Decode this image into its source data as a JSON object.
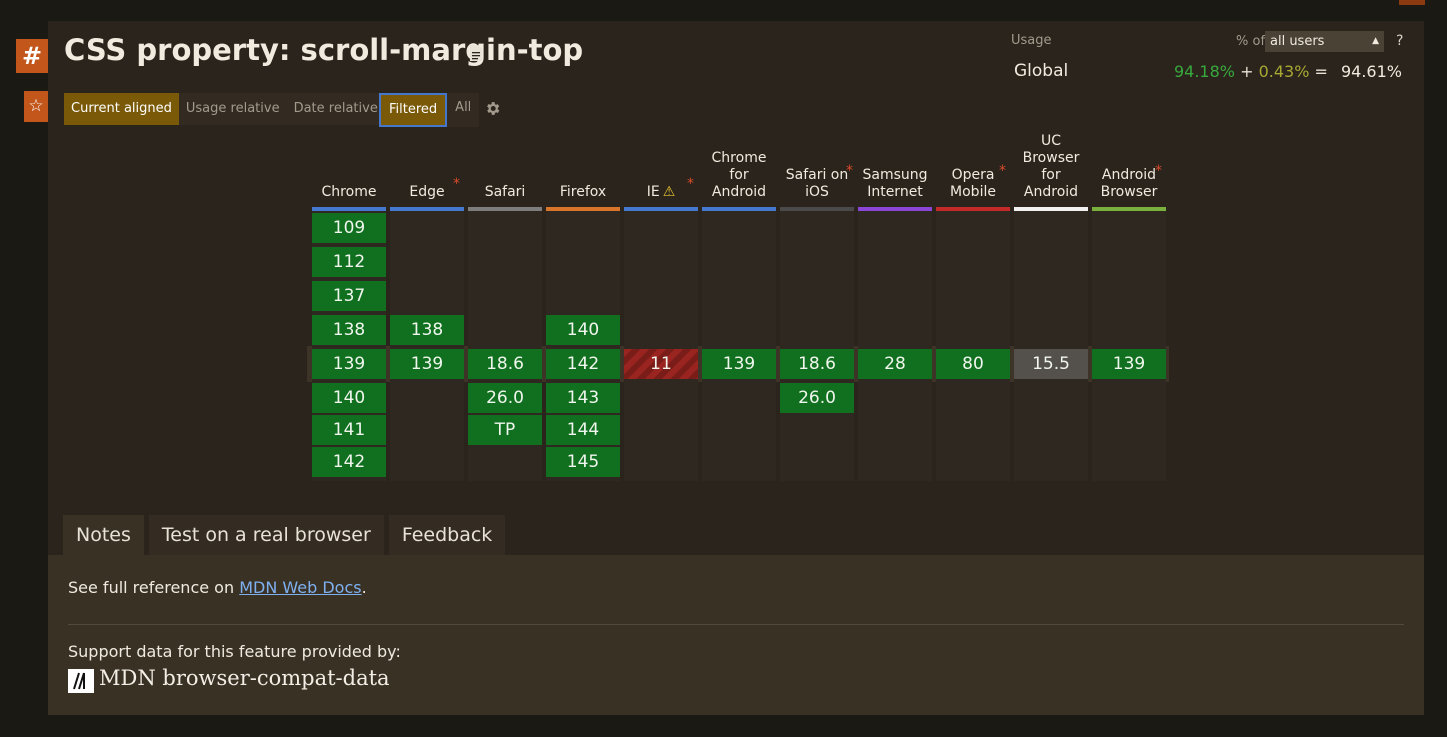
{
  "page": {
    "title": "CSS property: scroll-margin-top",
    "hash_icon": "hash-icon",
    "star_icon": "star-icon",
    "doc_icon": "document-icon"
  },
  "views": {
    "buttons": [
      {
        "label": "Current aligned",
        "active": true
      },
      {
        "label": "Usage relative",
        "active": false
      },
      {
        "label": "Date relative",
        "active": false
      }
    ],
    "filters": [
      {
        "label": "Filtered",
        "active": true
      },
      {
        "label": "All",
        "active": false
      }
    ],
    "settings_icon": "gear-icon"
  },
  "usage": {
    "label": "Usage",
    "pct_of": "% of",
    "select_value": "all users",
    "help": "?",
    "region": "Global",
    "full": "94.18%",
    "plus": "+",
    "partial": "0.43%",
    "equals": "=",
    "total": "94.61%"
  },
  "colors": {
    "supported": "#11701f",
    "unsupported": "#9a2420",
    "unknown": "#54514c",
    "accent": "#c2561b"
  },
  "browsers": [
    {
      "name": "Chrome",
      "color": "#4479cf",
      "note": false,
      "warn": false,
      "versions": [
        "109",
        "112",
        "137",
        "138",
        "139",
        "140",
        "141",
        "142"
      ]
    },
    {
      "name": "Edge",
      "color": "#4479cf",
      "note": true,
      "warn": false,
      "versions": [
        "",
        "",
        "",
        "138",
        "139",
        "",
        "",
        ""
      ]
    },
    {
      "name": "Safari",
      "color": "#7d7d7d",
      "note": false,
      "warn": false,
      "versions": [
        "",
        "",
        "",
        "",
        "18.6",
        "26.0",
        "TP",
        ""
      ]
    },
    {
      "name": "Firefox",
      "color": "#d9752b",
      "note": false,
      "warn": false,
      "versions": [
        "",
        "",
        "",
        "140",
        "142",
        "143",
        "144",
        "145"
      ]
    },
    {
      "name": "IE",
      "color": "#4479cf",
      "note": true,
      "warn": true,
      "versions": [
        "",
        "",
        "",
        "",
        "11",
        "",
        "",
        ""
      ]
    },
    {
      "name": "Chrome for Android",
      "color": "#4479cf",
      "note": false,
      "warn": false,
      "versions": [
        "",
        "",
        "",
        "",
        "139",
        "",
        "",
        ""
      ]
    },
    {
      "name": "Safari on iOS",
      "color": "#4a4a4a",
      "note": true,
      "warn": false,
      "versions": [
        "",
        "",
        "",
        "",
        "18.6",
        "26.0",
        "",
        ""
      ]
    },
    {
      "name": "Samsung Internet",
      "color": "#8b46d8",
      "note": false,
      "warn": false,
      "versions": [
        "",
        "",
        "",
        "",
        "28",
        "",
        "",
        ""
      ]
    },
    {
      "name": "Opera Mobile",
      "color": "#c52a2a",
      "note": true,
      "warn": false,
      "versions": [
        "",
        "",
        "",
        "",
        "80",
        "",
        "",
        ""
      ]
    },
    {
      "name": "UC Browser for Android",
      "color": "#f0f0f0",
      "note": false,
      "warn": false,
      "versions": [
        "",
        "",
        "",
        "",
        "15.5",
        "",
        "",
        ""
      ]
    },
    {
      "name": "Android Browser",
      "color": "#7ab03c",
      "note": true,
      "warn": false,
      "versions": [
        "",
        "",
        "",
        "",
        "139",
        "",
        "",
        ""
      ]
    }
  ],
  "cell_status": {
    "IE": "unsupported",
    "UC Browser for Android": "unknown"
  },
  "tabs": [
    {
      "label": "Notes",
      "active": true
    },
    {
      "label": "Test on a real browser",
      "active": false
    },
    {
      "label": "Feedback",
      "active": false
    }
  ],
  "notes": {
    "prefix": "See full reference on ",
    "link": "MDN Web Docs",
    "suffix": ".",
    "support": "Support data for this feature provided by:",
    "provider": "MDN browser-compat-data",
    "provider_logo": "mdn-logo-icon"
  }
}
